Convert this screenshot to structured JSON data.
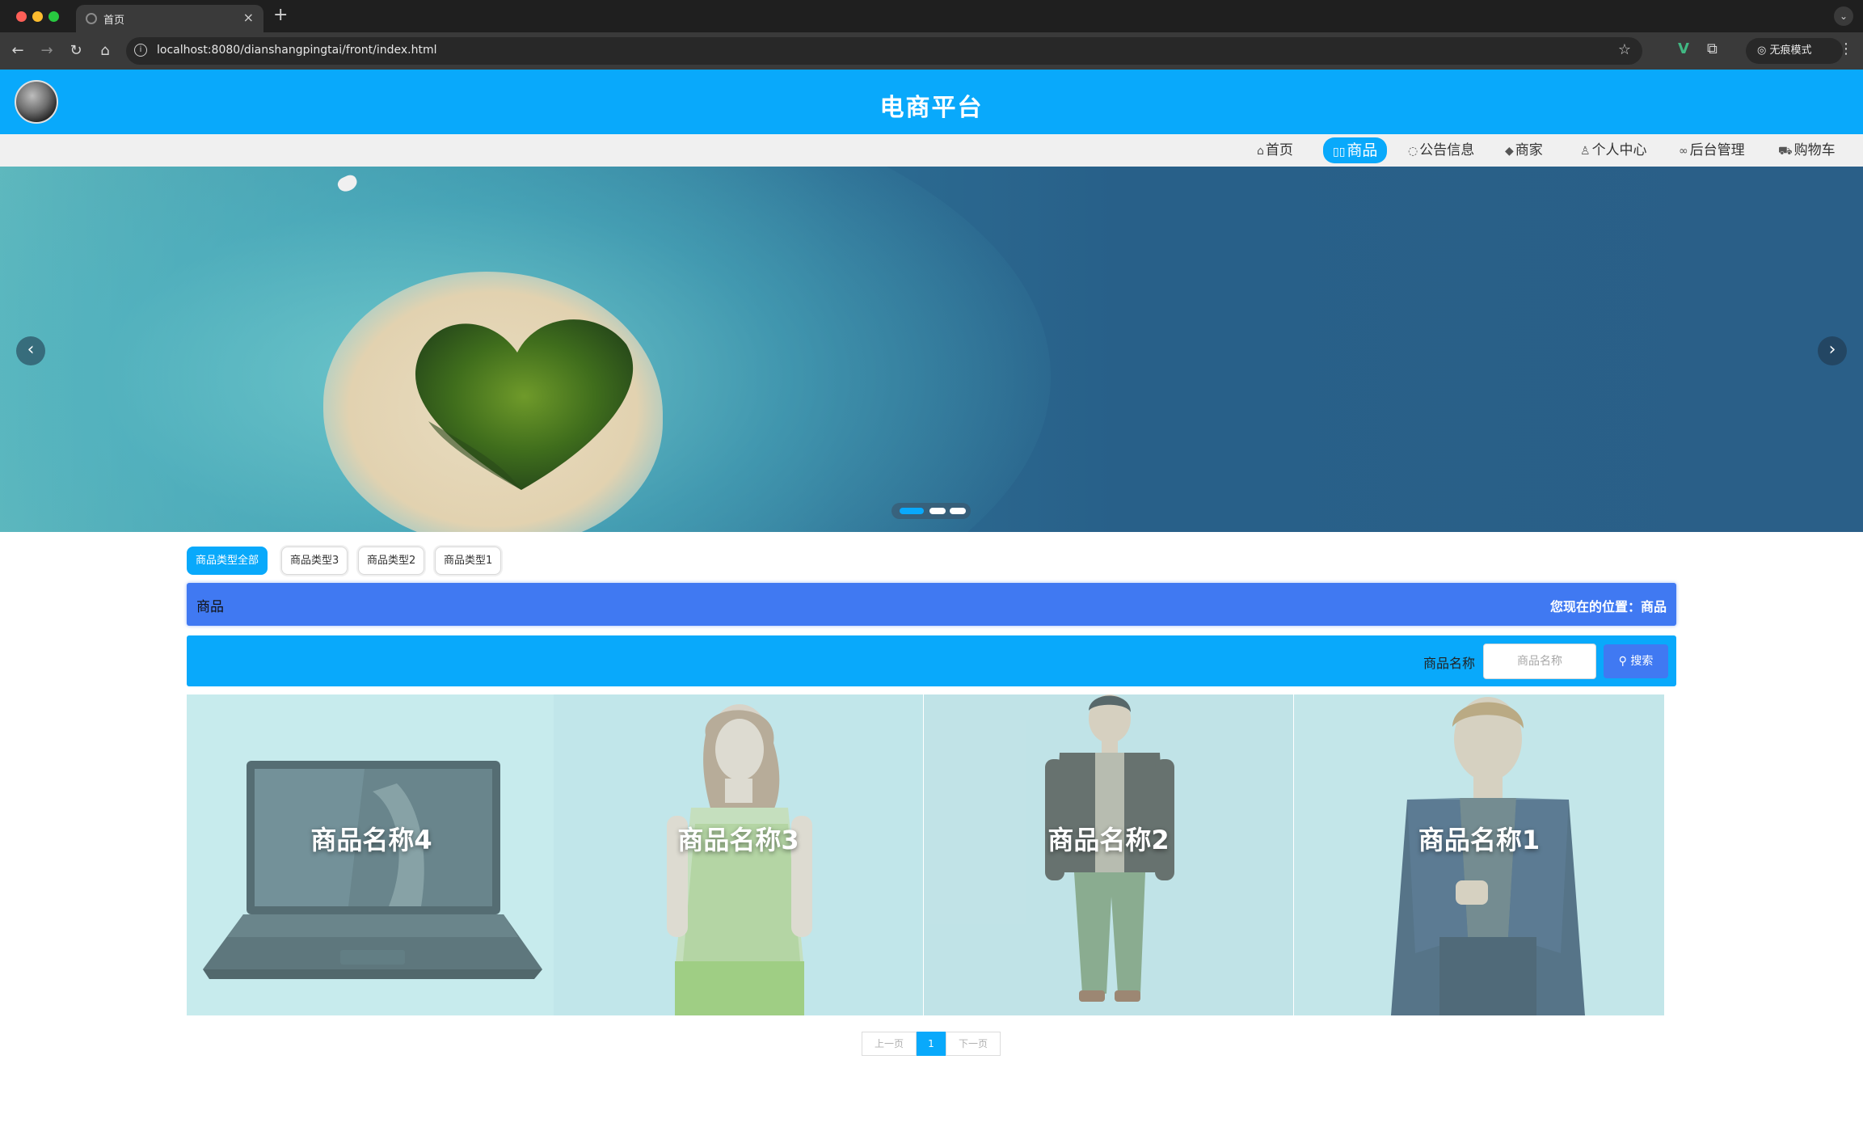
{
  "browser": {
    "tab_title": "首页",
    "url": "localhost:8080/dianshangpingtai/front/index.html",
    "incognito_label": "无痕模式"
  },
  "header": {
    "title": "电商平台"
  },
  "nav": {
    "items": [
      {
        "icon": "⌂",
        "label": "首页"
      },
      {
        "icon": "▯▯",
        "label": "商品"
      },
      {
        "icon": "◌",
        "label": "公告信息"
      },
      {
        "icon": "◆",
        "label": "商家"
      },
      {
        "icon": "♙",
        "label": "个人中心"
      },
      {
        "icon": "∞",
        "label": "后台管理"
      },
      {
        "icon": "⛟",
        "label": "购物车"
      }
    ],
    "active_index": 1
  },
  "banner": {
    "slide_count": 3,
    "active_slide": 0,
    "accent_color": "#09a9fb"
  },
  "categories": [
    {
      "label": "商品类型全部",
      "active": true
    },
    {
      "label": "商品类型3",
      "active": false
    },
    {
      "label": "商品类型2",
      "active": false
    },
    {
      "label": "商品类型1",
      "active": false
    }
  ],
  "breadcrumb": {
    "title": "商品",
    "location": "您现在的位置：商品"
  },
  "search": {
    "label": "商品名称",
    "placeholder": "商品名称",
    "value": "",
    "button_label": "搜索"
  },
  "products": [
    {
      "name": "商品名称4",
      "image": "laptop"
    },
    {
      "name": "商品名称3",
      "image": "woman-green-top"
    },
    {
      "name": "商品名称2",
      "image": "man-dark-jacket"
    },
    {
      "name": "商品名称1",
      "image": "man-leather-jacket"
    }
  ],
  "pagination": {
    "prev_label": "上一页",
    "current_page": "1",
    "next_label": "下一页"
  },
  "colors": {
    "header_blue": "#09a9fb",
    "crumb_blue": "#4079f2",
    "nav_bg": "#f0f0f0"
  }
}
